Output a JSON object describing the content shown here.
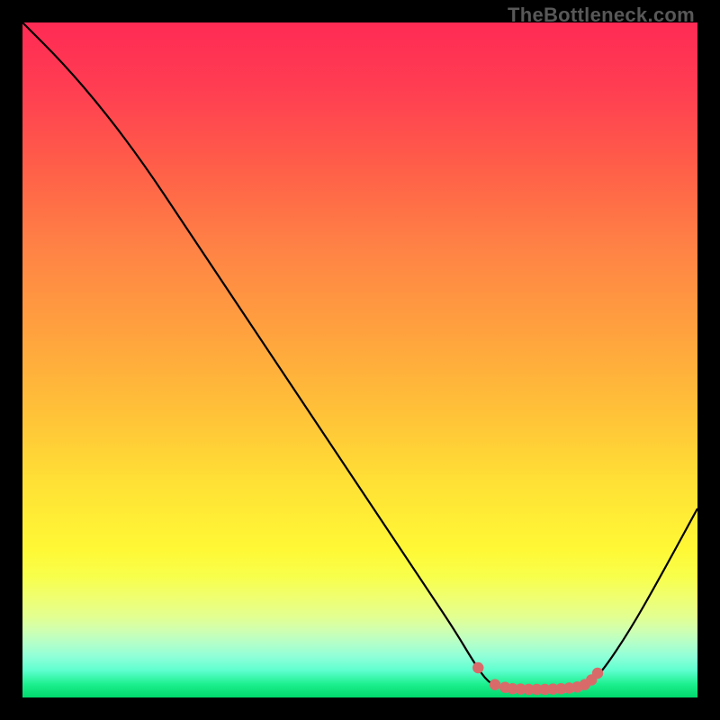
{
  "watermark": "TheBottleneck.com",
  "chart_data": {
    "type": "line",
    "title": "",
    "xlabel": "",
    "ylabel": "",
    "xlim": [
      0,
      100
    ],
    "ylim": [
      0,
      100
    ],
    "curve": [
      {
        "x": 0,
        "y": 100
      },
      {
        "x": 6,
        "y": 94
      },
      {
        "x": 12,
        "y": 87
      },
      {
        "x": 18,
        "y": 79
      },
      {
        "x": 24,
        "y": 70
      },
      {
        "x": 30,
        "y": 61
      },
      {
        "x": 36,
        "y": 52
      },
      {
        "x": 42,
        "y": 43
      },
      {
        "x": 48,
        "y": 34
      },
      {
        "x": 54,
        "y": 25
      },
      {
        "x": 60,
        "y": 16
      },
      {
        "x": 64,
        "y": 10
      },
      {
        "x": 67,
        "y": 5
      },
      {
        "x": 69,
        "y": 2.2
      },
      {
        "x": 71,
        "y": 1.4
      },
      {
        "x": 73,
        "y": 1.2
      },
      {
        "x": 76,
        "y": 1.2
      },
      {
        "x": 79,
        "y": 1.2
      },
      {
        "x": 82,
        "y": 1.4
      },
      {
        "x": 84,
        "y": 2.1
      },
      {
        "x": 86,
        "y": 4
      },
      {
        "x": 90,
        "y": 10
      },
      {
        "x": 94,
        "y": 17
      },
      {
        "x": 100,
        "y": 28
      }
    ],
    "markers": [
      {
        "x": 67.5,
        "y": 4.4
      },
      {
        "x": 70.0,
        "y": 1.9
      },
      {
        "x": 71.5,
        "y": 1.5
      },
      {
        "x": 72.6,
        "y": 1.3
      },
      {
        "x": 73.8,
        "y": 1.25
      },
      {
        "x": 75.0,
        "y": 1.2
      },
      {
        "x": 76.2,
        "y": 1.2
      },
      {
        "x": 77.4,
        "y": 1.2
      },
      {
        "x": 78.6,
        "y": 1.25
      },
      {
        "x": 79.8,
        "y": 1.3
      },
      {
        "x": 81.0,
        "y": 1.4
      },
      {
        "x": 82.2,
        "y": 1.55
      },
      {
        "x": 83.3,
        "y": 1.9
      },
      {
        "x": 84.3,
        "y": 2.6
      },
      {
        "x": 85.2,
        "y": 3.6
      }
    ],
    "colors": {
      "curve": "#000000",
      "marker": "#d96a6a"
    }
  }
}
